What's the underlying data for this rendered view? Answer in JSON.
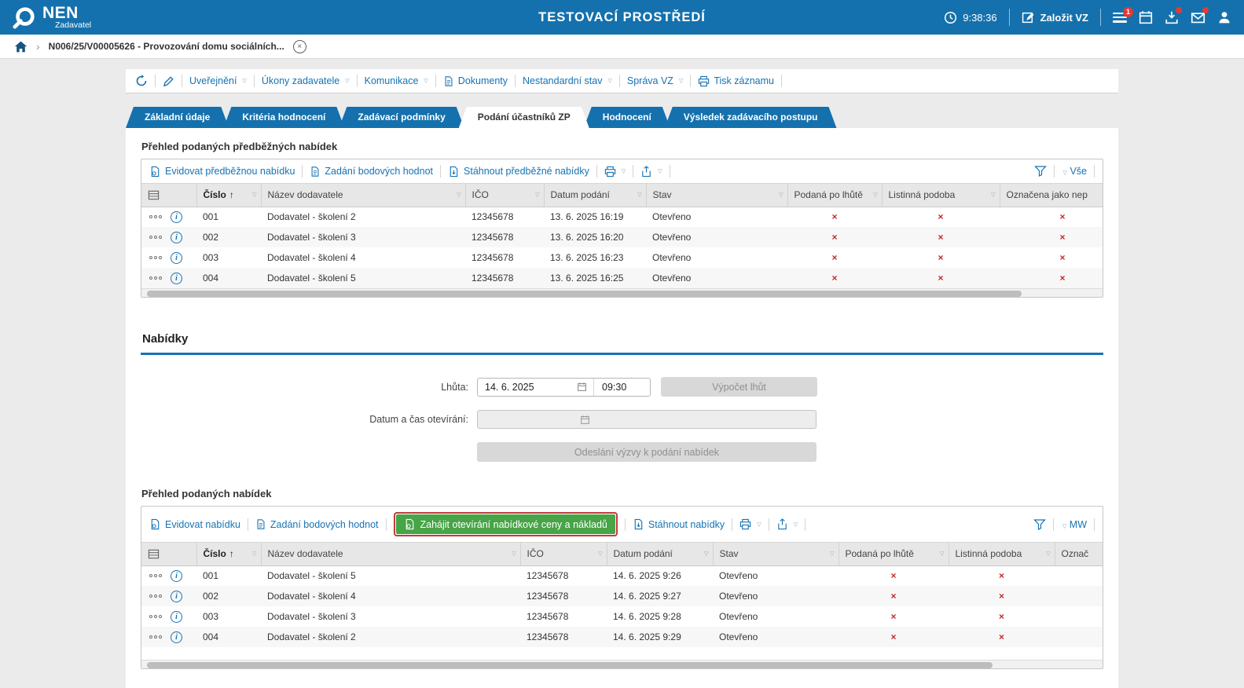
{
  "header": {
    "logo": "NEN",
    "logo_sub": "Zadavatel",
    "env_title": "TESTOVACÍ PROSTŘEDÍ",
    "time": "9:38:36",
    "new_vz": "Založit VZ",
    "menu_badge": "1"
  },
  "breadcrumb": {
    "record": "N006/25/V00005626 - Provozování domu sociálních..."
  },
  "command_bar": {
    "uverejneni": "Uveřejnění",
    "ukony": "Úkony zadavatele",
    "komunikace": "Komunikace",
    "dokumenty": "Dokumenty",
    "nestandardni": "Nestandardní stav",
    "sprava": "Správa VZ",
    "tisk": "Tisk záznamu"
  },
  "tabs": [
    "Základní údaje",
    "Kritéria hodnocení",
    "Zadávací podmínky",
    "Podání účastníků ZP",
    "Hodnocení",
    "Výsledek zadávacího postupu"
  ],
  "prelim": {
    "title": "Přehled podaných předběžných nabídek",
    "action_register": "Evidovat předběžnou nabídku",
    "action_points": "Zadání bodových hodnot",
    "action_download": "Stáhnout předběžné nabídky",
    "view": "Vše",
    "columns": {
      "number": "Číslo",
      "supplier": "Název dodavatele",
      "ico": "IČO",
      "date": "Datum podání",
      "status": "Stav",
      "late": "Podaná po lhůtě",
      "paper": "Listinná podoba",
      "marked": "Označena jako nep"
    },
    "rows": [
      {
        "number": "001",
        "supplier": "Dodavatel - školení 2",
        "ico": "12345678",
        "date": "13. 6. 2025 16:19",
        "status": "Otevřeno"
      },
      {
        "number": "002",
        "supplier": "Dodavatel - školení 3",
        "ico": "12345678",
        "date": "13. 6. 2025 16:20",
        "status": "Otevřeno"
      },
      {
        "number": "003",
        "supplier": "Dodavatel - školení 4",
        "ico": "12345678",
        "date": "13. 6. 2025 16:23",
        "status": "Otevřeno"
      },
      {
        "number": "004",
        "supplier": "Dodavatel - školení 5",
        "ico": "12345678",
        "date": "13. 6. 2025 16:25",
        "status": "Otevřeno"
      }
    ]
  },
  "nabidky": {
    "title": "Nabídky",
    "lhuta_label": "Lhůta:",
    "lhuta_date": "14. 6. 2025",
    "lhuta_time": "09:30",
    "vypocet_btn": "Výpočet lhůt",
    "otevirani_label": "Datum a čas otevírání:",
    "odeslani_btn": "Odeslání výzvy k podání nabídek"
  },
  "offers": {
    "title": "Přehled podaných nabídek",
    "action_register": "Evidovat nabídku",
    "action_points": "Zadání bodových hodnot",
    "action_open": "Zahájit otevírání nabídkové ceny a nákladů",
    "action_download": "Stáhnout nabídky",
    "view": "MW",
    "columns": {
      "number": "Číslo",
      "supplier": "Název dodavatele",
      "ico": "IČO",
      "date": "Datum podání",
      "status": "Stav",
      "late": "Podaná po lhůtě",
      "paper": "Listinná podoba",
      "marked": "Označ"
    },
    "rows": [
      {
        "number": "001",
        "supplier": "Dodavatel - školení 5",
        "ico": "12345678",
        "date": "14. 6. 2025 9:26",
        "status": "Otevřeno"
      },
      {
        "number": "002",
        "supplier": "Dodavatel - školení 4",
        "ico": "12345678",
        "date": "14. 6. 2025 9:27",
        "status": "Otevřeno"
      },
      {
        "number": "003",
        "supplier": "Dodavatel - školení 3",
        "ico": "12345678",
        "date": "14. 6. 2025 9:28",
        "status": "Otevřeno"
      },
      {
        "number": "004",
        "supplier": "Dodavatel - školení 2",
        "ico": "12345678",
        "date": "14. 6. 2025 9:29",
        "status": "Otevřeno"
      }
    ]
  }
}
